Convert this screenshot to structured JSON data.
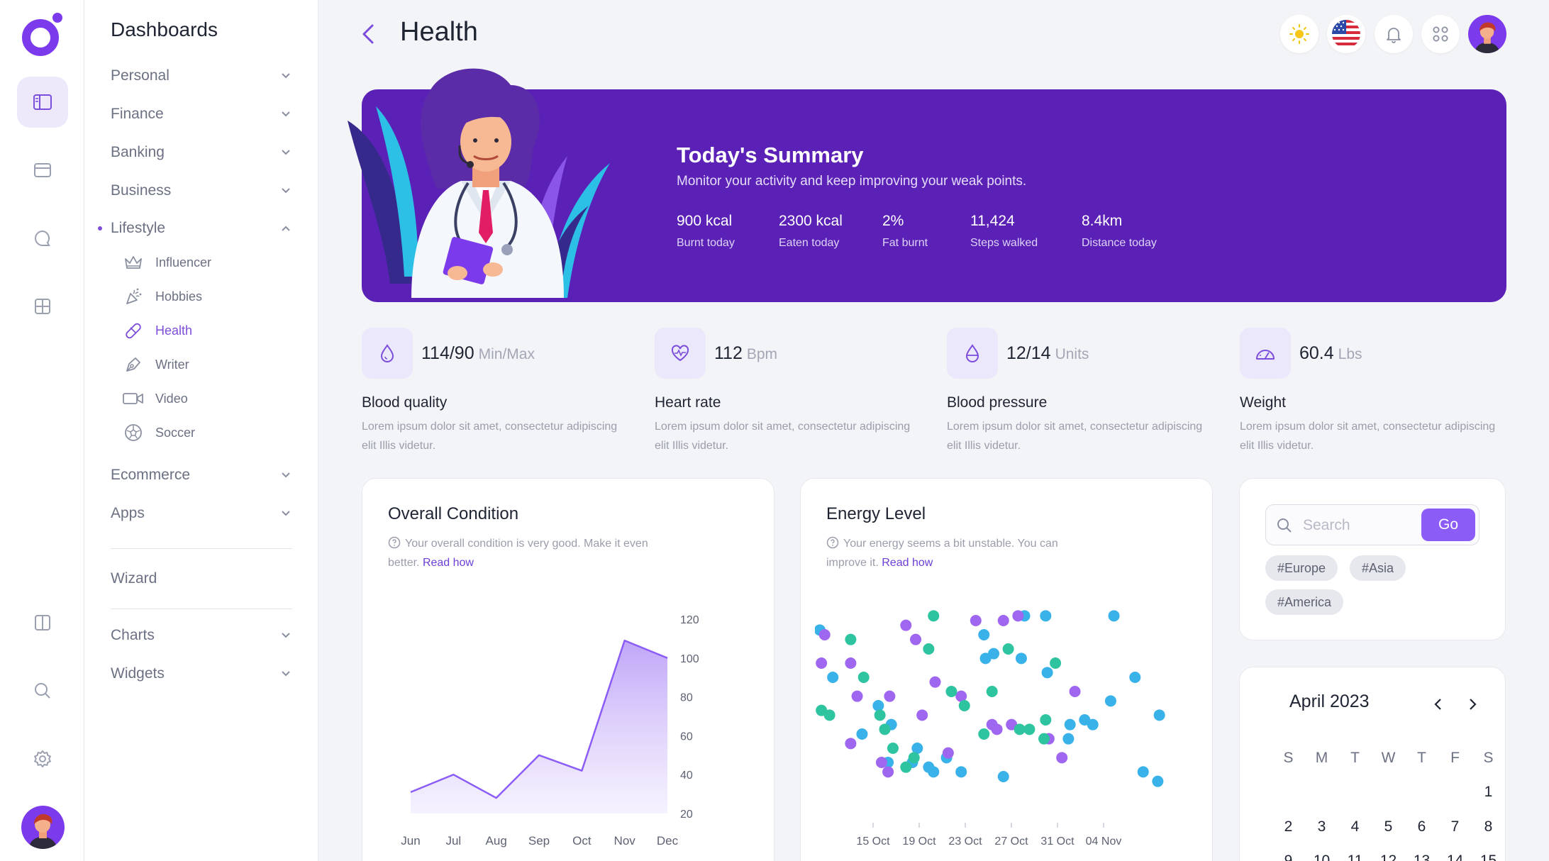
{
  "app": {
    "page_title": "Health"
  },
  "rail": {
    "icons": [
      "sidebar-icon",
      "browser-icon",
      "chat-icon",
      "grid-icon",
      "columns-icon",
      "search-icon",
      "settings-icon"
    ]
  },
  "menu": {
    "title": "Dashboards",
    "items": [
      {
        "label": "Personal"
      },
      {
        "label": "Finance"
      },
      {
        "label": "Banking"
      },
      {
        "label": "Business"
      },
      {
        "label": "Lifestyle"
      }
    ],
    "subitems": [
      {
        "label": "Influencer",
        "icon": "crown-icon"
      },
      {
        "label": "Hobbies",
        "icon": "party-icon"
      },
      {
        "label": "Health",
        "icon": "pill-icon"
      },
      {
        "label": "Writer",
        "icon": "pen-icon"
      },
      {
        "label": "Video",
        "icon": "video-icon"
      },
      {
        "label": "Soccer",
        "icon": "soccer-icon"
      }
    ],
    "items2": [
      {
        "label": "Ecommerce"
      },
      {
        "label": "Apps"
      }
    ],
    "wizard": "Wizard",
    "items3": [
      {
        "label": "Charts"
      },
      {
        "label": "Widgets"
      }
    ]
  },
  "topbar": {
    "icons": [
      "sun-icon",
      "us-flag-icon",
      "bell-icon",
      "apps-icon",
      "avatar"
    ]
  },
  "banner": {
    "title": "Today's Summary",
    "subtitle": "Monitor your activity and keep improving your weak points.",
    "stats": [
      {
        "value": "900 kcal",
        "label": "Burnt today"
      },
      {
        "value": "2300 kcal",
        "label": "Eaten today"
      },
      {
        "value": "2%",
        "label": "Fat burnt"
      },
      {
        "value": "11,424",
        "label": "Steps walked"
      },
      {
        "value": "8.4km",
        "label": "Distance today"
      }
    ]
  },
  "metrics": [
    {
      "value": "114/90",
      "unit": "Min/Max",
      "name": "Blood quality",
      "desc": "Lorem ipsum dolor sit amet, consectetur adipiscing elit Illis videtur.",
      "icon": "drop-icon"
    },
    {
      "value": "112",
      "unit": "Bpm",
      "name": "Heart rate",
      "desc": "Lorem ipsum dolor sit amet, consectetur adipiscing elit Illis videtur.",
      "icon": "heartbeat-icon"
    },
    {
      "value": "12/14",
      "unit": "Units",
      "name": "Blood pressure",
      "desc": "Lorem ipsum dolor sit amet, consectetur adipiscing elit Illis videtur.",
      "icon": "droplet-half-icon"
    },
    {
      "value": "60.4",
      "unit": "Lbs",
      "name": "Weight",
      "desc": "Lorem ipsum dolor sit amet, consectetur adipiscing elit Illis videtur.",
      "icon": "gauge-icon"
    }
  ],
  "overall": {
    "title": "Overall Condition",
    "note": "Your overall condition is very good. Make it even better.",
    "link": "Read how"
  },
  "energy": {
    "title": "Energy Level",
    "note": "Your energy seems a bit unstable. You can improve it.",
    "link": "Read how"
  },
  "search": {
    "placeholder": "Search",
    "go": "Go",
    "tags": [
      "#Europe",
      "#Asia",
      "#America"
    ]
  },
  "calendar": {
    "month": "April 2023",
    "weekdays": [
      "S",
      "M",
      "T",
      "W",
      "T",
      "F",
      "S"
    ],
    "row1": [
      "",
      "",
      "",
      "",
      "",
      "",
      "1"
    ],
    "row2": [
      "2",
      "3",
      "4",
      "5",
      "6",
      "7",
      "8"
    ],
    "row3": [
      "9",
      "10",
      "11",
      "12",
      "13",
      "14",
      "15"
    ]
  },
  "chart_data": [
    {
      "type": "area",
      "title": "Overall Condition",
      "categories": [
        "Jun",
        "Jul",
        "Aug",
        "Sep",
        "Oct",
        "Nov",
        "Dec"
      ],
      "series": [
        {
          "values": [
            31,
            40,
            28,
            50,
            42,
            109,
            100
          ]
        }
      ],
      "ylim": [
        20,
        120
      ],
      "yticks": [
        20,
        40,
        60,
        80,
        100,
        120
      ],
      "color": "#8b5cf6"
    },
    {
      "type": "scatter",
      "title": "Energy Level",
      "xticks": [
        "15 Oct",
        "19 Oct",
        "23 Oct",
        "27 Oct",
        "31 Oct",
        "04 Nov"
      ],
      "colors": [
        "#38b2e8",
        "#9f67f0",
        "#2ec4a0"
      ],
      "series": [
        {
          "values": [
            [
              13.3,
              92
            ],
            [
              14.1,
              82
            ],
            [
              15.9,
              70
            ],
            [
              16.9,
              76
            ],
            [
              17.5,
              64
            ],
            [
              17.7,
              72
            ],
            [
              19,
              64
            ],
            [
              19.3,
              67
            ],
            [
              20,
              63
            ],
            [
              20.3,
              62
            ],
            [
              21.1,
              65
            ],
            [
              22,
              62
            ],
            [
              23.4,
              91
            ],
            [
              23.5,
              86
            ],
            [
              24,
              87
            ],
            [
              24.6,
              61
            ],
            [
              25.7,
              86
            ],
            [
              25.9,
              95
            ],
            [
              27.2,
              95
            ],
            [
              27.3,
              83
            ],
            [
              28.6,
              69
            ],
            [
              28.7,
              72
            ],
            [
              29.6,
              73
            ],
            [
              30.1,
              72
            ],
            [
              31.2,
              77
            ],
            [
              31.4,
              95
            ],
            [
              32.7,
              82
            ],
            [
              33.2,
              62
            ],
            [
              34.1,
              60
            ],
            [
              34.2,
              74
            ]
          ]
        },
        {
          "values": [
            [
              13.6,
              91
            ],
            [
              13.4,
              85
            ],
            [
              15.2,
              85
            ],
            [
              15.6,
              78
            ],
            [
              15.2,
              68
            ],
            [
              17.1,
              64
            ],
            [
              17.5,
              62
            ],
            [
              17.6,
              78
            ],
            [
              18.6,
              93
            ],
            [
              19.2,
              90
            ],
            [
              19.6,
              74
            ],
            [
              20.4,
              81
            ],
            [
              21.2,
              66
            ],
            [
              22,
              78
            ],
            [
              22.9,
              94
            ],
            [
              23.9,
              72
            ],
            [
              24.2,
              71
            ],
            [
              24.6,
              94
            ],
            [
              25.1,
              72
            ],
            [
              25.5,
              95
            ],
            [
              27.4,
              69
            ],
            [
              28.2,
              65
            ],
            [
              29,
              79
            ]
          ]
        },
        {
          "values": [
            [
              13.4,
              75
            ],
            [
              13.9,
              74
            ],
            [
              15.2,
              90
            ],
            [
              16,
              82
            ],
            [
              17,
              74
            ],
            [
              17.3,
              71
            ],
            [
              17.8,
              67
            ],
            [
              18.6,
              63
            ],
            [
              19.1,
              65
            ],
            [
              20,
              88
            ],
            [
              20.3,
              95
            ],
            [
              21.4,
              79
            ],
            [
              22.2,
              76
            ],
            [
              23.4,
              70
            ],
            [
              23.9,
              79
            ],
            [
              24.9,
              88
            ],
            [
              25.6,
              71
            ],
            [
              26.2,
              71
            ],
            [
              27.1,
              69
            ],
            [
              27.2,
              73
            ],
            [
              27.8,
              85
            ]
          ]
        }
      ]
    }
  ]
}
